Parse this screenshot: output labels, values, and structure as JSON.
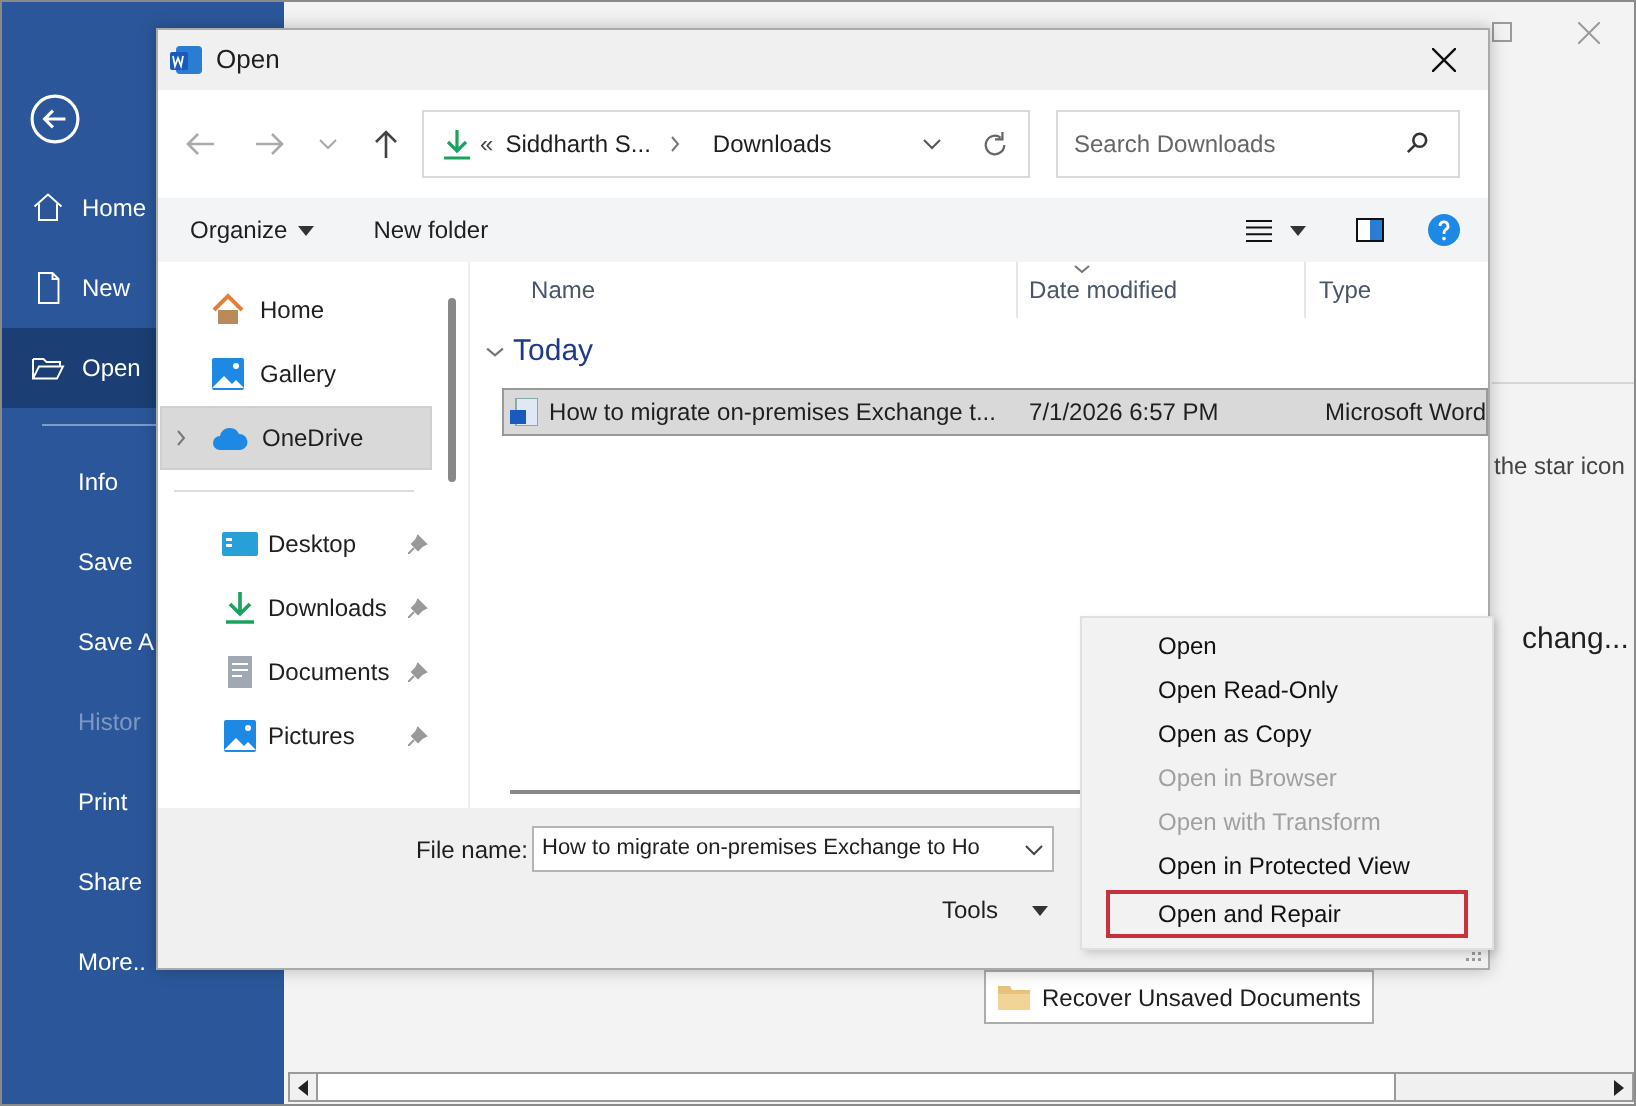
{
  "backstage": {
    "nav_top": [
      {
        "label": "Home",
        "selected": false,
        "disabled": false
      },
      {
        "label": "New",
        "selected": false,
        "disabled": false
      },
      {
        "label": "Open",
        "selected": true,
        "disabled": false
      }
    ],
    "nav_bottom": [
      {
        "label": "Info",
        "selected": false,
        "disabled": false
      },
      {
        "label": "Save",
        "selected": false,
        "disabled": false
      },
      {
        "label": "Save A",
        "selected": false,
        "disabled": false
      },
      {
        "label": "Histor",
        "selected": false,
        "disabled": true
      },
      {
        "label": "Print",
        "selected": false,
        "disabled": false
      },
      {
        "label": "Share",
        "selected": false,
        "disabled": false
      },
      {
        "label": "More..",
        "selected": false,
        "disabled": false
      }
    ],
    "hint_text": "the star icon",
    "recent_text": "chang...",
    "recover_button": "Recover Unsaved Documents"
  },
  "dialog": {
    "title": "Open",
    "path_prefix": "«",
    "path": [
      "Siddharth S...",
      "Downloads"
    ],
    "search_placeholder": "Search Downloads",
    "toolbar": [
      "Organize",
      "New folder"
    ],
    "nav_pane": {
      "top": [
        {
          "label": "Home",
          "kind": "home",
          "selected": false
        },
        {
          "label": "Gallery",
          "kind": "gallery",
          "selected": false
        },
        {
          "label": "OneDrive",
          "kind": "cloud",
          "selected": true
        }
      ],
      "pinned": [
        {
          "label": "Desktop",
          "kind": "desktop"
        },
        {
          "label": "Downloads",
          "kind": "download"
        },
        {
          "label": "Documents",
          "kind": "document"
        },
        {
          "label": "Pictures",
          "kind": "gallery"
        }
      ]
    },
    "columns": [
      "Name",
      "Date modified",
      "Type"
    ],
    "group": {
      "label": "Today",
      "expanded": true
    },
    "rows": [
      {
        "name": "How to migrate on-premises Exchange t...",
        "date": "7/1/2026 6:57 PM",
        "type": "Microsoft Word",
        "selected": true
      }
    ],
    "file_name_label": "File name:",
    "file_name": "How to migrate on-premises Exchange to Ho",
    "tools": "Tools"
  },
  "tools_menu": [
    {
      "label": "Open",
      "disabled": false,
      "selected": false
    },
    {
      "label": "Open Read-Only",
      "disabled": false,
      "selected": false
    },
    {
      "label": "Open as Copy",
      "disabled": false,
      "selected": false
    },
    {
      "label": "Open in Browser",
      "disabled": true,
      "selected": false
    },
    {
      "label": "Open with Transform",
      "disabled": true,
      "selected": false
    },
    {
      "label": "Open in Protected View",
      "disabled": false,
      "selected": false
    },
    {
      "label": "Open and Repair",
      "disabled": false,
      "selected": true
    }
  ]
}
